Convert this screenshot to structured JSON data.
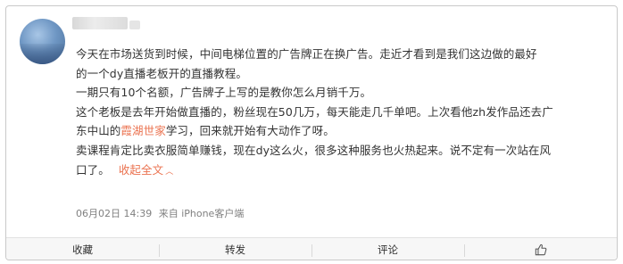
{
  "post": {
    "username": "",
    "content_lines": [
      "今天在市场送货到时候，中间电梯位置的广告牌正在换广告。走近才看到是我们这边做的最好",
      "的一个dy直播老板开的直播教程。",
      "一期只有10个名额，广告牌子上写的是教你怎么月销千万。",
      "这个老板是去年开始做直播的，粉丝现在50几万，每天能走几千单吧。上次看他zh发作品还去广"
    ],
    "line5_prefix": "东中山的",
    "line5_mention": "霞湖世家",
    "line5_suffix": "学习，回来就开始有大动作了呀。",
    "line6": "卖课程肯定比卖衣服简单赚钱，现在dy这么火，很多这种服务也火热起来。说不定有一次站在风",
    "line7": "口了。",
    "expand_label": "收起全文",
    "expand_chevron": "︿",
    "date": "06月02日 14:39",
    "source": "来自 iPhone客户端"
  },
  "actions": {
    "favorite": "收藏",
    "repost": "转发",
    "comment": "评论"
  },
  "colors": {
    "link": "#eb7350",
    "meta": "#808080",
    "action_bar": "#f7f7f7"
  },
  "icons": {
    "like": "thumbs-up-icon"
  }
}
